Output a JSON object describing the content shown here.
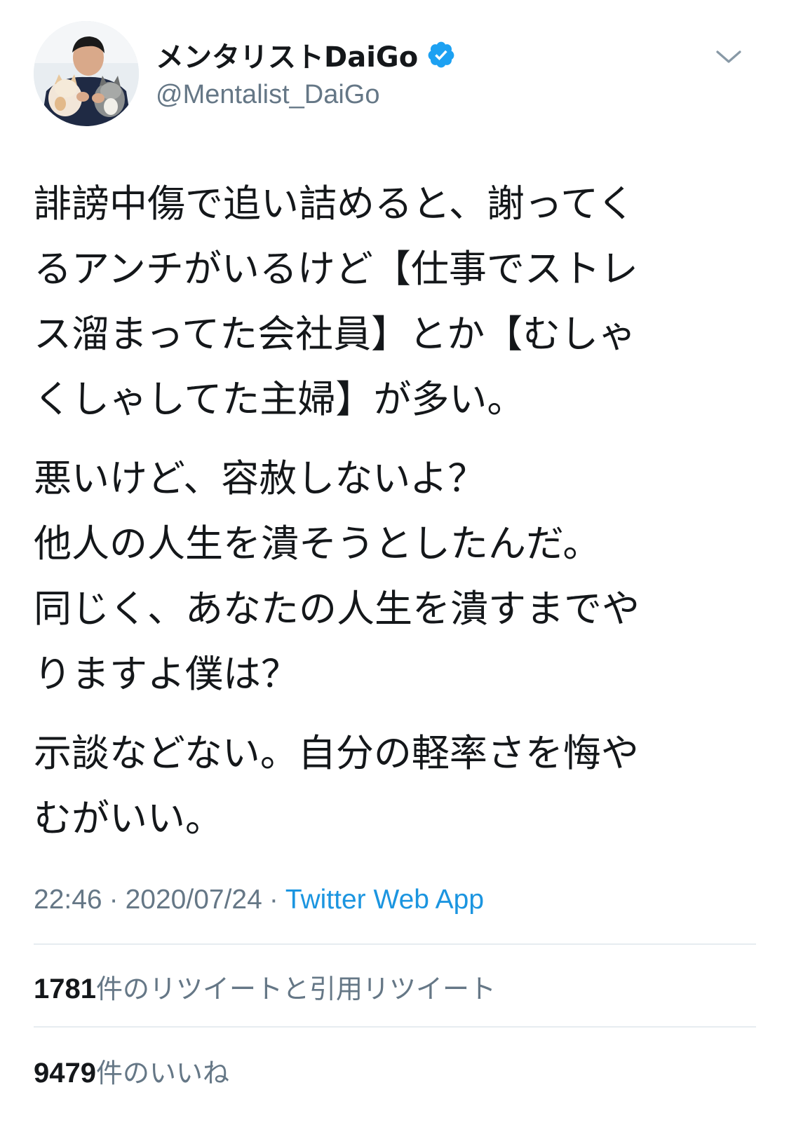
{
  "user": {
    "display_name": "メンタリストDaiGo",
    "handle": "@Mentalist_DaiGo",
    "verified": true,
    "verified_color": "#1da1f2"
  },
  "icons": {
    "more": "chevron-down-icon",
    "verified": "verified-badge-icon",
    "avatar": "profile-avatar"
  },
  "tweet": {
    "paragraphs": [
      {
        "lines": [
          "誹謗中傷で追い詰めると、謝ってく",
          "るアンチがいるけど【仕事でストレ",
          "ス溜まってた会社員】とか【むしゃ",
          "くしゃしてた主婦】が多い。"
        ]
      },
      {
        "lines": [
          "悪いけど、容赦しないよ？",
          "他人の人生を潰そうとしたんだ。",
          "同じく、あなたの人生を潰すまでや",
          "りますよ僕は？"
        ]
      },
      {
        "lines": [
          "示談などない。自分の軽率さを悔や",
          "むがいい。"
        ]
      }
    ]
  },
  "meta": {
    "time": "22:46",
    "separator": "·",
    "date": "2020/07/24",
    "source": "Twitter Web App"
  },
  "stats": {
    "retweets": {
      "count": "1781",
      "label": "件のリツイートと引用リツイート"
    },
    "likes": {
      "count": "9479",
      "label": "件のいいね"
    }
  },
  "colors": {
    "text": "#14171a",
    "secondary": "#657786",
    "link": "#1b95e0",
    "divider": "#e6ecf0"
  }
}
